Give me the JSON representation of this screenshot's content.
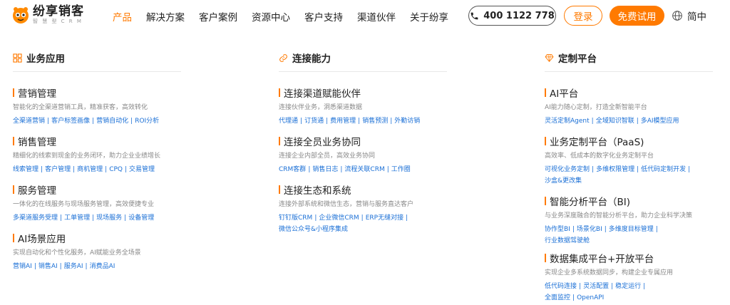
{
  "header": {
    "logo_name": "纷享销客",
    "logo_sub": "智 慧 型 C R M",
    "nav": [
      "产品",
      "解决方案",
      "客户案例",
      "资源中心",
      "客户支持",
      "渠道伙伴",
      "关于纷享"
    ],
    "phone": "400 1122 778",
    "login": "登录",
    "trial": "免费试用",
    "lang": "简中",
    "accent": "#ff7a00"
  },
  "columns": [
    {
      "title": "业务应用",
      "icon": "grid-icon",
      "sections": [
        {
          "title": "营销管理",
          "desc": "智能化的全渠道营销工具，精准获客，高效转化",
          "links": [
            "全渠道营销",
            "客户标签画像",
            "营销自动化",
            "ROI分析"
          ]
        },
        {
          "title": "销售管理",
          "desc": "精细化的线索到现金的业务闭环，助力企业业绩增长",
          "links": [
            "线索管理",
            "客户管理",
            "商机管理",
            "CPQ",
            "交易管理"
          ]
        },
        {
          "title": "服务管理",
          "desc": "一体化的在线服务与现场服务管理，高效便捷专业",
          "links": [
            "多渠道服务受理",
            "工单管理",
            "现场服务",
            "设备管理"
          ]
        },
        {
          "title": "AI场景应用",
          "desc": "实现自动化和个性化服务，AI赋能业务全场景",
          "links": [
            "营销AI",
            "销售AI",
            "服务AI",
            "消费品AI"
          ]
        }
      ]
    },
    {
      "title": "连接能力",
      "icon": "link-icon",
      "sections": [
        {
          "title": "连接渠道赋能伙伴",
          "desc": "连接伙伴业务，洞悉渠道数据",
          "links": [
            "代理通",
            "订货通",
            "费用管理",
            "销售预测",
            "外勤访销"
          ]
        },
        {
          "title": "连接全员业务协同",
          "desc": "连接企业内部全员，高效业务协同",
          "links": [
            "CRM客群",
            "销售日志",
            "流程关联CRM",
            "工作圈"
          ]
        },
        {
          "title": "连接生态和系统",
          "desc": "连接外部系统和微信生态，营销与服务直达客户",
          "links": [
            "钉钉版CRM",
            "企业微信CRM",
            "ERP无缝对接",
            "微信公众号&小程序集成"
          ]
        }
      ]
    },
    {
      "title": "定制平台",
      "icon": "diamond-icon",
      "sections": [
        {
          "title": "AI平台",
          "desc": "AI能力随心定制，打造全新智能平台",
          "links": [
            "灵活定制Agent",
            "全域知识智联",
            "多AI模型应用"
          ]
        },
        {
          "title": "业务定制平台（PaaS)",
          "desc": "高效率、低成本的数字化业务定制平台",
          "links": [
            "可视化业务定制",
            "多维权限管理",
            "低代码定制开发",
            "沙盒&更改集"
          ]
        },
        {
          "title": "智能分析平台（BI)",
          "desc": "与业务深度融合的智能分析平台，助力企业科学决策",
          "links": [
            "协作型BI",
            "场景化BI",
            "多维度目标管理",
            "行业数据驾驶舱"
          ]
        },
        {
          "title": "数据集成平台+开放平台",
          "desc": "实现企业多系统数据同步，构建企业专属应用",
          "links": [
            "低代码连接",
            "灵活配置",
            "稳定运行",
            "全面监控",
            "OpenAPI"
          ]
        }
      ]
    }
  ]
}
